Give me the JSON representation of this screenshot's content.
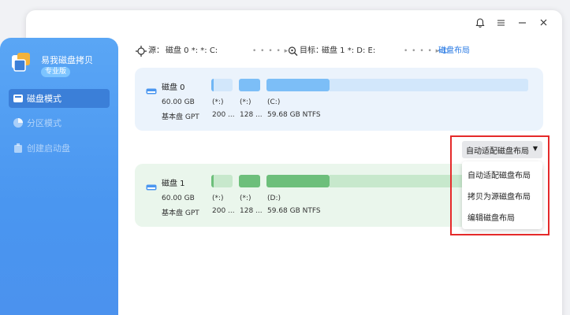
{
  "app": {
    "name": "易我磁盘拷贝",
    "edition": "专业版"
  },
  "sidebar": {
    "items": [
      {
        "label": "磁盘模式",
        "active": true
      },
      {
        "label": "分区模式",
        "active": false
      },
      {
        "label": "创建启动盘",
        "active": false
      }
    ]
  },
  "topbar": {
    "source": "源：",
    "source_value": "磁盘 0 *: *: C:",
    "target": "目标：",
    "target_value": "磁盘 1 *: D: E:",
    "layout_link": "磁盘布局"
  },
  "disks": [
    {
      "name": "磁盘 0",
      "size": "60.00 GB",
      "type": "基本盘 GPT",
      "partitions": [
        {
          "label": "(*:)",
          "detail": "200 ..."
        },
        {
          "label": "(*:)",
          "detail": "128 ..."
        },
        {
          "label": "(C:)",
          "detail": "59.68 GB NTFS"
        }
      ]
    },
    {
      "name": "磁盘 1",
      "size": "60.00 GB",
      "type": "基本盘 GPT",
      "partitions": [
        {
          "label": "(*:)",
          "detail": "200 ..."
        },
        {
          "label": "(*:)",
          "detail": "128 ..."
        },
        {
          "label": "(D:)",
          "detail": "59.68 GB NTFS"
        }
      ]
    }
  ],
  "dropdown": {
    "selected": "自动适配磁盘布局",
    "options": [
      "自动适配磁盘布局",
      "拷贝为源磁盘布局",
      "编辑磁盘布局"
    ]
  },
  "colors": {
    "accent": "#2b7be4",
    "sidebar": "#4a96f0",
    "disk0_bar": "#a7d3f7",
    "disk1_bar": "#7ac88a",
    "highlight": "#e52a2a"
  }
}
